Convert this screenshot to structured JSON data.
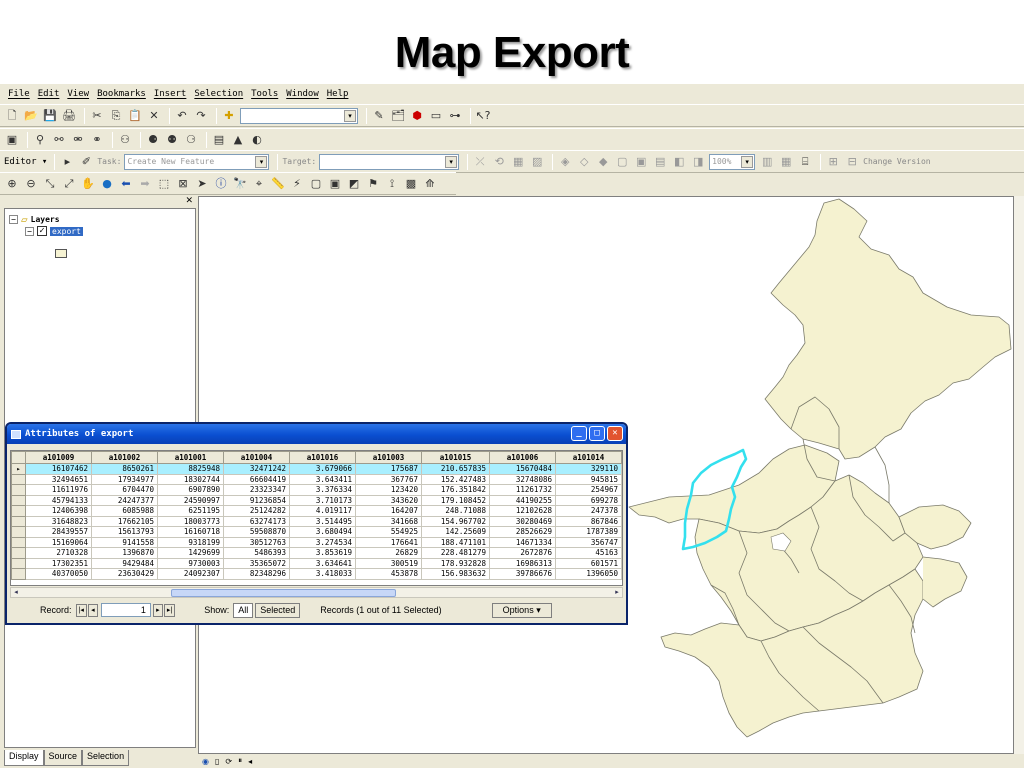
{
  "slide": {
    "title": "Map Export"
  },
  "menu": [
    "File",
    "Edit",
    "View",
    "Bookmarks",
    "Insert",
    "Selection",
    "Tools",
    "Window",
    "Help"
  ],
  "toolbar": {
    "editor_label": "Editor ▾",
    "task_label": "Task:",
    "task_value": "Create New Feature",
    "target_label": "Target:",
    "zoom_value": "100%",
    "change_version": "Change Version"
  },
  "toc": {
    "root_label": "Layers",
    "layer_label": "export",
    "tabs": [
      "Display",
      "Source",
      "Selection"
    ]
  },
  "attributes": {
    "title": "Attributes of export",
    "columns": [
      "a101009",
      "a101002",
      "a101001",
      "a101004",
      "a101016",
      "a101003",
      "a101015",
      "a101006",
      "a101014"
    ],
    "rows": [
      [
        "16107462",
        "8650261",
        "8825948",
        "32471242",
        "3.679066",
        "175687",
        "210.657835",
        "15670484",
        "329110"
      ],
      [
        "32494651",
        "17934977",
        "18302744",
        "66604419",
        "3.643411",
        "367767",
        "152.427483",
        "32748086",
        "945815"
      ],
      [
        "11611976",
        "6704470",
        "6907890",
        "23323347",
        "3.376334",
        "123420",
        "176.351842",
        "11261732",
        "254967"
      ],
      [
        "45794133",
        "24247377",
        "24590997",
        "91236854",
        "3.710173",
        "343620",
        "179.108452",
        "44190255",
        "699278"
      ],
      [
        "12406398",
        "6085988",
        "6251195",
        "25124282",
        "4.019117",
        "164207",
        "248.71088",
        "12102628",
        "247378"
      ],
      [
        "31648823",
        "17662105",
        "18003773",
        "63274173",
        "3.514495",
        "341668",
        "154.967702",
        "30280469",
        "867846"
      ],
      [
        "28439557",
        "15613793",
        "16160718",
        "59508870",
        "3.680494",
        "554925",
        "142.25609",
        "28526629",
        "1787389"
      ],
      [
        "15169064",
        "9141558",
        "9318199",
        "30512763",
        "3.274534",
        "176641",
        "188.471101",
        "14671334",
        "356747"
      ],
      [
        "2710328",
        "1396870",
        "1429699",
        "5486393",
        "3.853619",
        "26829",
        "228.481279",
        "2672876",
        "45163"
      ],
      [
        "17302351",
        "9429484",
        "9730003",
        "35365072",
        "3.634641",
        "300519",
        "178.932828",
        "16986313",
        "601571"
      ],
      [
        "40370050",
        "23630429",
        "24092307",
        "82348296",
        "3.418033",
        "453878",
        "156.983632",
        "39786676",
        "1396050"
      ]
    ],
    "selected_row": 0,
    "record_label": "Record:",
    "record_value": "1",
    "show_label": "Show:",
    "show_all": "All",
    "show_selected": "Selected",
    "records_status": "Records (1 out of 11 Selected)",
    "options_label": "Options ▾"
  },
  "colors": {
    "map_fill": "#f5f2d0",
    "map_stroke": "#7a7a6a",
    "highlight": "#33e0ee",
    "selected_row": "#a9efff",
    "title_bar": "#0a4fd1"
  }
}
